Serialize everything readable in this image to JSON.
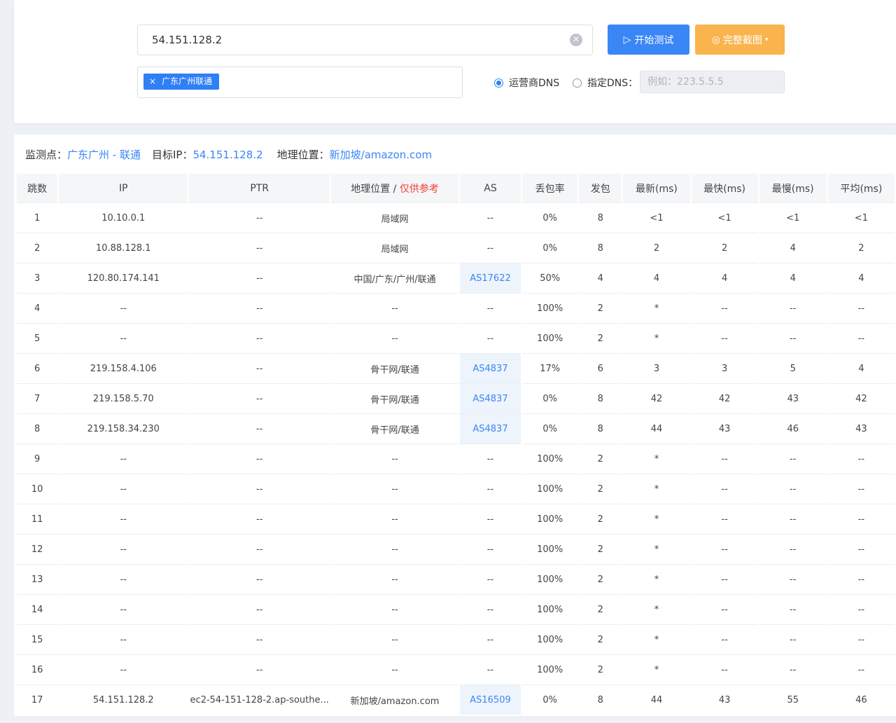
{
  "query": {
    "target": "54.151.128.2",
    "start_label": "开始测试",
    "screenshot_label": "完整截图",
    "node_tag": "广东广州联通",
    "dns_options": [
      "运营商DNS",
      "指定DNS"
    ],
    "dns_selected": "运营商DNS",
    "dns_placeholder": "例如：223.5.5.5",
    "colors": {
      "primary": "#3a86f6",
      "warning": "#f9b44e",
      "danger": "#f04134"
    }
  },
  "summary": {
    "monitor_label": "监测点：",
    "monitor_value": "广东广州 - 联通",
    "target_label": "目标IP：",
    "target_value": "54.151.128.2",
    "geo_label": "地理位置：",
    "geo_value": "新加坡/amazon.com"
  },
  "table": {
    "headers": {
      "hop": "跳数",
      "ip": "IP",
      "ptr": "PTR",
      "geo": "地理位置",
      "geo_slash": " / ",
      "geo_note": "仅供参考",
      "as": "AS",
      "loss": "丢包率",
      "sent": "发包",
      "last": "最新(ms)",
      "best": "最快(ms)",
      "worst": "最慢(ms)",
      "avg": "平均(ms)"
    },
    "rows": [
      [
        "1",
        "10.10.0.1",
        "--",
        "局域网",
        "--",
        "0%",
        "8",
        "<1",
        "<1",
        "<1",
        "<1"
      ],
      [
        "2",
        "10.88.128.1",
        "--",
        "局域网",
        "--",
        "0%",
        "8",
        "2",
        "2",
        "4",
        "2"
      ],
      [
        "3",
        "120.80.174.141",
        "--",
        "中国/广东/广州/联通",
        "AS17622",
        "50%",
        "4",
        "4",
        "4",
        "4",
        "4"
      ],
      [
        "4",
        "--",
        "--",
        "--",
        "--",
        "100%",
        "2",
        "*",
        "--",
        "--",
        "--"
      ],
      [
        "5",
        "--",
        "--",
        "--",
        "--",
        "100%",
        "2",
        "*",
        "--",
        "--",
        "--"
      ],
      [
        "6",
        "219.158.4.106",
        "--",
        "骨干网/联通",
        "AS4837",
        "17%",
        "6",
        "3",
        "3",
        "5",
        "4"
      ],
      [
        "7",
        "219.158.5.70",
        "--",
        "骨干网/联通",
        "AS4837",
        "0%",
        "8",
        "42",
        "42",
        "43",
        "42"
      ],
      [
        "8",
        "219.158.34.230",
        "--",
        "骨干网/联通",
        "AS4837",
        "0%",
        "8",
        "44",
        "43",
        "46",
        "43"
      ],
      [
        "9",
        "--",
        "--",
        "--",
        "--",
        "100%",
        "2",
        "*",
        "--",
        "--",
        "--"
      ],
      [
        "10",
        "--",
        "--",
        "--",
        "--",
        "100%",
        "2",
        "*",
        "--",
        "--",
        "--"
      ],
      [
        "11",
        "--",
        "--",
        "--",
        "--",
        "100%",
        "2",
        "*",
        "--",
        "--",
        "--"
      ],
      [
        "12",
        "--",
        "--",
        "--",
        "--",
        "100%",
        "2",
        "*",
        "--",
        "--",
        "--"
      ],
      [
        "13",
        "--",
        "--",
        "--",
        "--",
        "100%",
        "2",
        "*",
        "--",
        "--",
        "--"
      ],
      [
        "14",
        "--",
        "--",
        "--",
        "--",
        "100%",
        "2",
        "*",
        "--",
        "--",
        "--"
      ],
      [
        "15",
        "--",
        "--",
        "--",
        "--",
        "100%",
        "2",
        "*",
        "--",
        "--",
        "--"
      ],
      [
        "16",
        "--",
        "--",
        "--",
        "--",
        "100%",
        "2",
        "*",
        "--",
        "--",
        "--"
      ],
      [
        "17",
        "54.151.128.2",
        "ec2-54-151-128-2.ap-southe...",
        "新加坡/amazon.com",
        "AS16509",
        "0%",
        "8",
        "44",
        "43",
        "55",
        "46"
      ]
    ]
  }
}
